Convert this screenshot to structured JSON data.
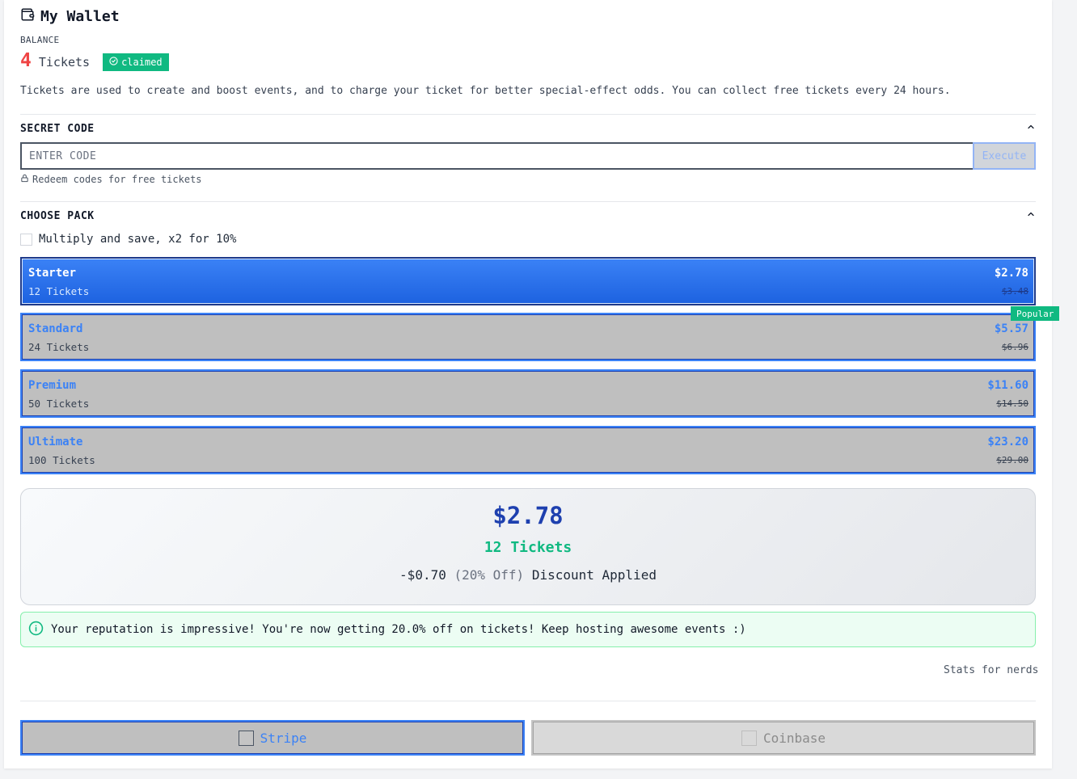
{
  "header": {
    "title": "My Wallet",
    "icon": "wallet-icon"
  },
  "balance": {
    "label": "BALANCE",
    "amount": "4",
    "unit": "Tickets",
    "badge": "claimed"
  },
  "description": "Tickets are used to create and boost events, and to charge your ticket for better special-effect odds. You can collect free tickets every 24 hours.",
  "secret_code": {
    "title": "SECRET CODE",
    "placeholder": "ENTER CODE",
    "value": "",
    "button": "Execute",
    "hint": "Redeem codes for free tickets"
  },
  "packs": {
    "title": "CHOOSE PACK",
    "multiply_label": "Multiply and save, x2 for 10%",
    "multiply_checked": false,
    "popular_label": "Popular",
    "items": [
      {
        "name": "Starter",
        "tickets": "12 Tickets",
        "price": "$2.78",
        "old_price": "$3.48",
        "selected": true
      },
      {
        "name": "Standard",
        "tickets": "24 Tickets",
        "price": "$5.57",
        "old_price": "$6.96",
        "selected": false,
        "popular": true
      },
      {
        "name": "Premium",
        "tickets": "50 Tickets",
        "price": "$11.60",
        "old_price": "$14.50",
        "selected": false
      },
      {
        "name": "Ultimate",
        "tickets": "100 Tickets",
        "price": "$23.20",
        "old_price": "$29.00",
        "selected": false
      }
    ]
  },
  "summary": {
    "price": "$2.78",
    "tickets": "12 Tickets",
    "discount_amount": "-$0.70",
    "discount_percent": "(20% Off)",
    "discount_label": "Discount Applied"
  },
  "info": {
    "message": "Your reputation is impressive! You're now getting 20.0% off on tickets! Keep hosting awesome events :)"
  },
  "stats_link": "Stats for nerds",
  "payment": {
    "stripe": "Stripe",
    "coinbase": "Coinbase"
  },
  "colors": {
    "accent": "#3b82f6",
    "success": "#10b981",
    "danger": "#ef4444",
    "price_summary": "#1e40af"
  }
}
